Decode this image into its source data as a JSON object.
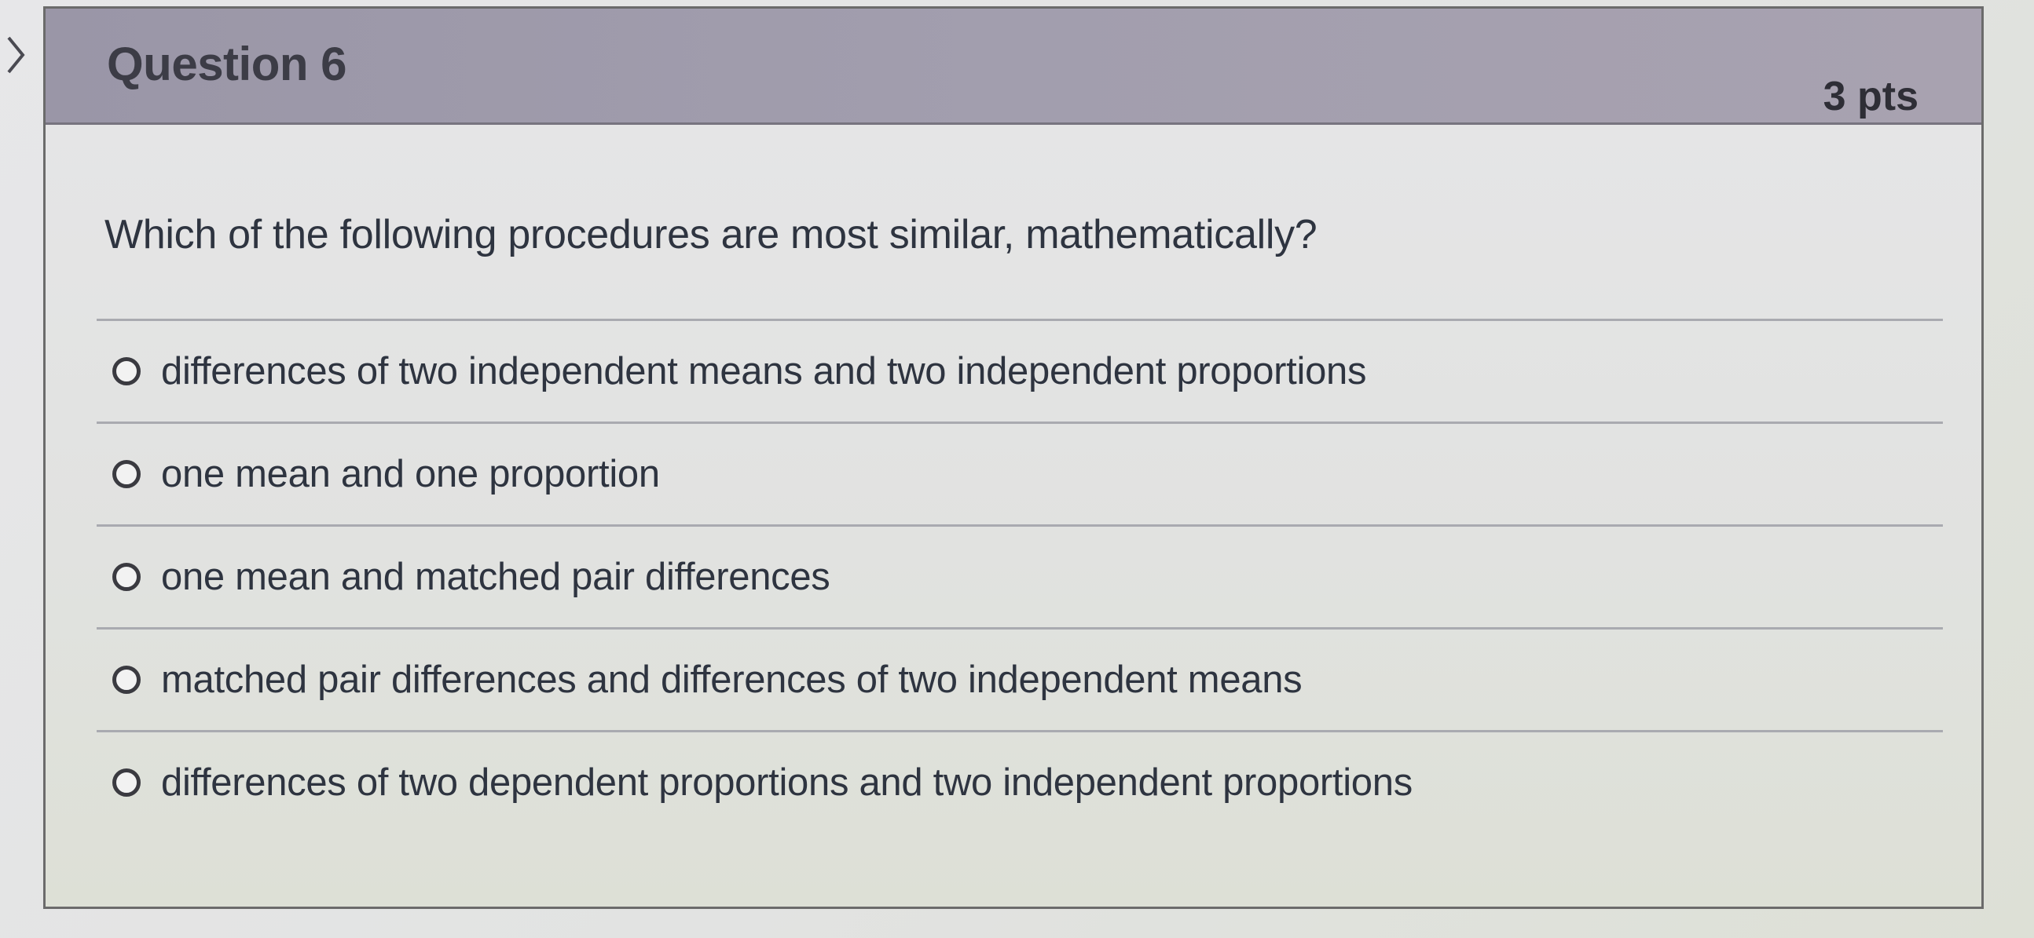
{
  "question": {
    "title": "Question 6",
    "points": "3 pts",
    "text": "Which of the following procedures are most similar, mathematically?"
  },
  "answers": [
    {
      "label": "differences of two independent means and two independent proportions",
      "selected": false
    },
    {
      "label": "one mean and one proportion",
      "selected": false
    },
    {
      "label": "one mean and matched pair differences",
      "selected": false
    },
    {
      "label": "matched pair differences and differences of two independent means",
      "selected": false
    },
    {
      "label": "differences of two dependent proportions and two independent proportions",
      "selected": false
    }
  ]
}
